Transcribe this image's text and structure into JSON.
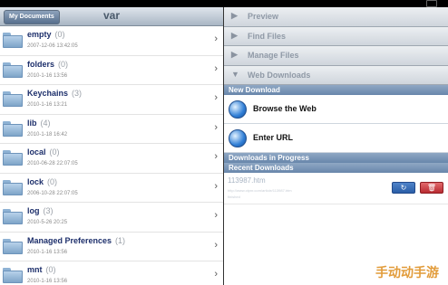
{
  "left_panel": {
    "back_label": "My Documents",
    "title": "var",
    "items": [
      {
        "name": "empty",
        "count": "(0)",
        "date": "2007-12-06 13:42:05"
      },
      {
        "name": "folders",
        "count": "(0)",
        "date": "2010-1-16 13:56"
      },
      {
        "name": "Keychains",
        "count": "(3)",
        "date": "2010-1-16 13:21"
      },
      {
        "name": "lib",
        "count": "(4)",
        "date": "2010-1-18 16:42"
      },
      {
        "name": "local",
        "count": "(0)",
        "date": "2010-06-28 22:07:05"
      },
      {
        "name": "lock",
        "count": "(0)",
        "date": "2006-10-28 22:07:05"
      },
      {
        "name": "log",
        "count": "(3)",
        "date": "2010-5-26 20:25"
      },
      {
        "name": "Managed Preferences",
        "count": "(1)",
        "date": "2010-1-16 13:56"
      },
      {
        "name": "mnt",
        "count": "(0)",
        "date": "2010-1-16 13:56"
      }
    ]
  },
  "right_panel": {
    "menu": [
      {
        "label": "Preview",
        "arrow": "▶"
      },
      {
        "label": "Find Files",
        "arrow": "▶"
      },
      {
        "label": "Manage Files",
        "arrow": "▶"
      },
      {
        "label": "Web Downloads",
        "arrow": "▼"
      }
    ],
    "new_download_header": "New Download",
    "actions": [
      {
        "label": "Browse the Web"
      },
      {
        "label": "Enter URL"
      }
    ],
    "progress_header": "Downloads in Progress",
    "recent_header": "Recent Downloads",
    "download": {
      "name": "113987.htm",
      "url": "http://www.ctpnr.com/article/113987.htm",
      "status": "finished"
    }
  },
  "watermark": "手动动手游",
  "colors": {
    "section_header": "#6f8cb0",
    "refresh": "#3a6fb8",
    "delete": "#c63b40",
    "title_text": "#1d2f6b"
  }
}
